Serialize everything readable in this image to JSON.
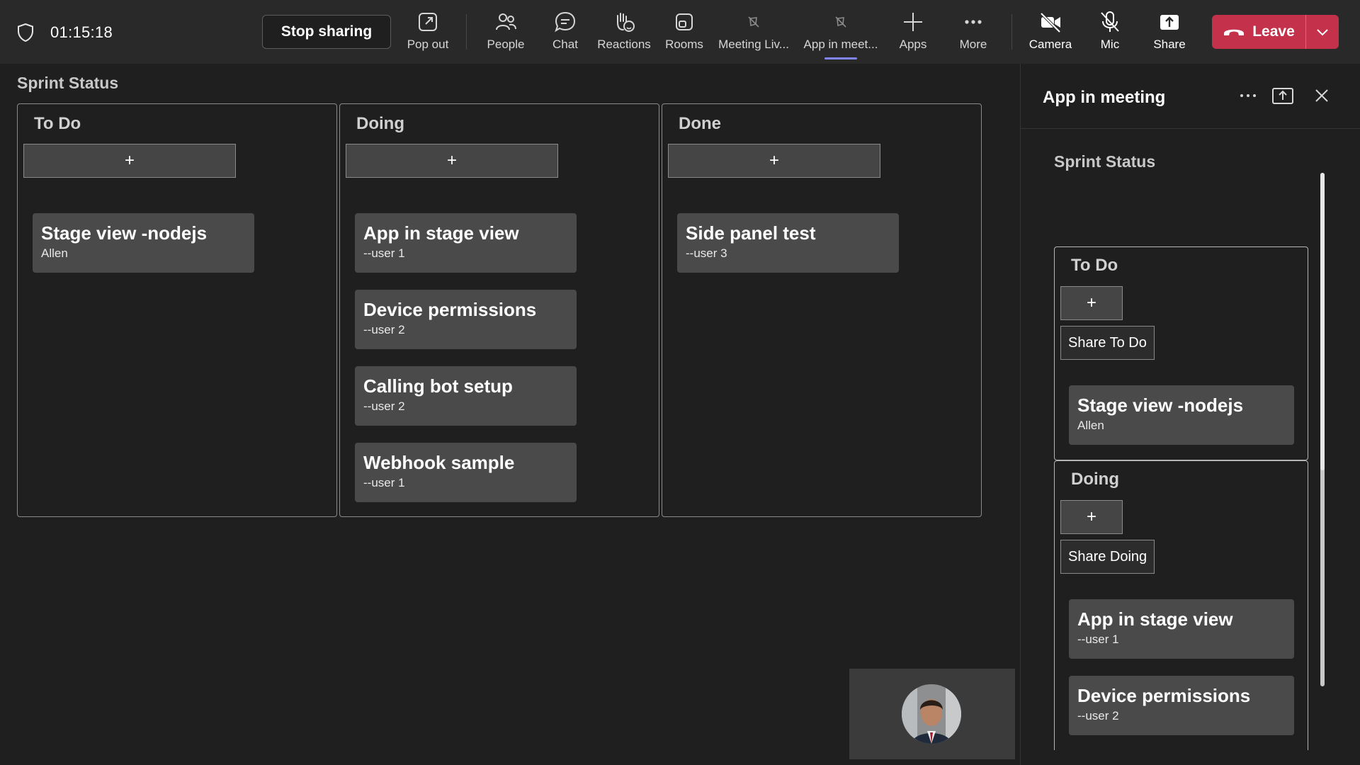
{
  "meeting": {
    "timer": "01:15:18",
    "stop_sharing": "Stop sharing",
    "toolbar": [
      {
        "label": "Pop out",
        "icon": "popout-icon"
      },
      {
        "label": "People",
        "icon": "people-icon"
      },
      {
        "label": "Chat",
        "icon": "chat-icon"
      },
      {
        "label": "Reactions",
        "icon": "reactions-icon"
      },
      {
        "label": "Rooms",
        "icon": "rooms-icon"
      },
      {
        "label": "Meeting Liv...",
        "icon": "meeting-live-icon"
      },
      {
        "label": "App in meet...",
        "icon": "app-in-meeting-icon"
      },
      {
        "label": "Apps",
        "icon": "add-icon"
      },
      {
        "label": "More",
        "icon": "more-icon"
      },
      {
        "label": "Camera",
        "icon": "camera-off-icon"
      },
      {
        "label": "Mic",
        "icon": "mic-off-icon"
      },
      {
        "label": "Share",
        "icon": "share-icon"
      }
    ],
    "leave": "Leave",
    "leave_color": "#c4314b",
    "active_tab_color": "#7f85f5"
  },
  "stage": {
    "title": "Sprint Status",
    "add_symbol": "+",
    "columns": [
      {
        "title": "To Do",
        "cards": [
          {
            "title": "Stage view -nodejs",
            "owner": "Allen"
          }
        ]
      },
      {
        "title": "Doing",
        "cards": [
          {
            "title": "App in stage view",
            "owner": "--user 1"
          },
          {
            "title": "Device permissions",
            "owner": "--user 2"
          },
          {
            "title": "Calling bot setup",
            "owner": "--user 2"
          },
          {
            "title": "Webhook sample",
            "owner": "--user 1"
          }
        ]
      },
      {
        "title": "Done",
        "cards": [
          {
            "title": "Side panel test",
            "owner": "--user 3"
          }
        ]
      }
    ]
  },
  "panel": {
    "title": "App in meeting",
    "board_title": "Sprint Status",
    "add_symbol": "+",
    "columns": [
      {
        "title": "To Do",
        "share": "Share To Do",
        "cards": [
          {
            "title": "Stage view -nodejs",
            "owner": "Allen"
          }
        ]
      },
      {
        "title": "Doing",
        "share": "Share Doing",
        "cards": [
          {
            "title": "App in stage view",
            "owner": "--user 1"
          },
          {
            "title": "Device permissions",
            "owner": "--user 2"
          }
        ]
      }
    ]
  }
}
